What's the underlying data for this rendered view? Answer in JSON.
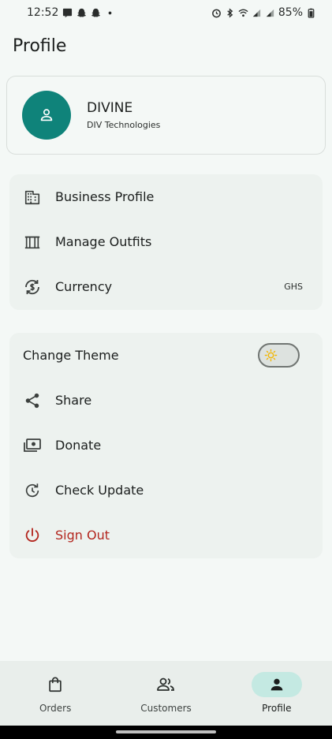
{
  "status_bar": {
    "time": "12:52",
    "battery": "85%",
    "left_icons": [
      "message-icon",
      "snapchat-icon",
      "snapchat-icon",
      "dot-icon"
    ],
    "right_icons": [
      "alarm-icon",
      "bluetooth-icon",
      "wifi-icon",
      "signal-icon",
      "signal-icon",
      "battery-icon"
    ]
  },
  "page": {
    "title": "Profile"
  },
  "profile": {
    "name": "DIVINE",
    "company": "DIV Technologies",
    "avatar_color": "#0f837a"
  },
  "menu_group_1": [
    {
      "label": "Business Profile",
      "icon": "building-icon"
    },
    {
      "label": "Manage Outfits",
      "icon": "outfits-icon"
    },
    {
      "label": "Currency",
      "icon": "currency-icon",
      "value": "GHS"
    }
  ],
  "menu_group_2": {
    "theme": {
      "label": "Change Theme",
      "icon": "sun-icon",
      "toggle_on": false
    },
    "items": [
      {
        "label": "Share",
        "icon": "share-icon"
      },
      {
        "label": "Donate",
        "icon": "donate-icon"
      },
      {
        "label": "Check Update",
        "icon": "update-icon"
      },
      {
        "label": "Sign Out",
        "icon": "power-icon",
        "color": "#b3261e"
      }
    ]
  },
  "bottom_nav": {
    "items": [
      {
        "label": "Orders",
        "icon": "bag-icon"
      },
      {
        "label": "Customers",
        "icon": "people-icon"
      },
      {
        "label": "Profile",
        "icon": "person-icon",
        "active": true
      }
    ],
    "active_color": "#c4e9e2"
  }
}
